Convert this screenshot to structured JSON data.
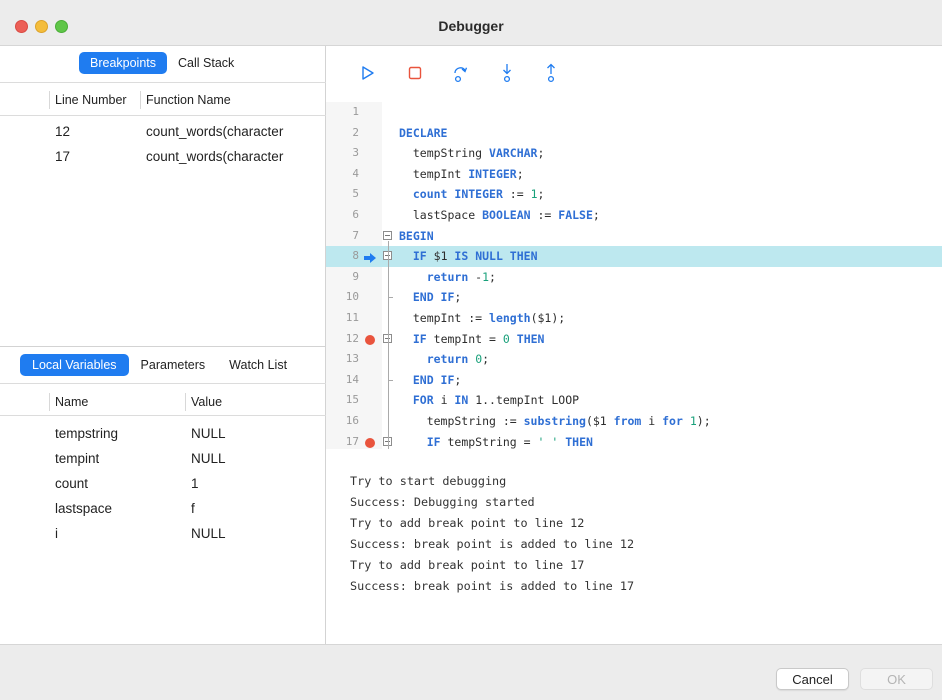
{
  "window": {
    "title": "Debugger"
  },
  "breakpoints_panel": {
    "tabs": [
      {
        "label": "Breakpoints",
        "active": true
      },
      {
        "label": "Call Stack",
        "active": false
      }
    ],
    "columns": [
      "Line Number",
      "Function Name"
    ],
    "rows": [
      {
        "line": "12",
        "function": "count_words(character"
      },
      {
        "line": "17",
        "function": "count_words(character"
      }
    ]
  },
  "variables_panel": {
    "tabs": [
      {
        "label": "Local Variables",
        "active": true
      },
      {
        "label": "Parameters",
        "active": false
      },
      {
        "label": "Watch List",
        "active": false
      }
    ],
    "columns": [
      "Name",
      "Value"
    ],
    "rows": [
      {
        "name": "tempstring",
        "value": "NULL"
      },
      {
        "name": "tempint",
        "value": "NULL"
      },
      {
        "name": "count",
        "value": "1"
      },
      {
        "name": "lastspace",
        "value": "f"
      },
      {
        "name": "i",
        "value": "NULL"
      }
    ]
  },
  "toolbar": {
    "buttons": [
      {
        "name": "continue-button",
        "icon": "play-icon"
      },
      {
        "name": "stop-button",
        "icon": "stop-icon"
      },
      {
        "name": "step-over-button",
        "icon": "step-over-icon"
      },
      {
        "name": "step-into-button",
        "icon": "step-into-icon"
      },
      {
        "name": "step-out-button",
        "icon": "step-out-icon"
      }
    ]
  },
  "editor": {
    "current_line": 8,
    "breakpoint_lines": [
      12,
      17
    ],
    "lines": [
      {
        "n": "1",
        "html": ""
      },
      {
        "n": "2",
        "html": "<span class=\"kw\">DECLARE</span>"
      },
      {
        "n": "3",
        "html": "  tempString <span class=\"kw\">VARCHAR</span>;"
      },
      {
        "n": "4",
        "html": "  tempInt <span class=\"kw\">INTEGER</span>;"
      },
      {
        "n": "5",
        "html": "  <span class=\"kw\">count INTEGER</span> := <span class=\"num\">1</span>;"
      },
      {
        "n": "6",
        "html": "  lastSpace <span class=\"kw\">BOOLEAN</span> := <span class=\"kw\">FALSE</span>;"
      },
      {
        "n": "7",
        "html": "<span class=\"kw\">BEGIN</span>"
      },
      {
        "n": "8",
        "html": "  <span class=\"kw\">IF</span> $1 <span class=\"kw\">IS NULL THEN</span>"
      },
      {
        "n": "9",
        "html": "    <span class=\"kw\">return</span> -<span class=\"num\">1</span>;"
      },
      {
        "n": "10",
        "html": "  <span class=\"kw\">END IF</span>;"
      },
      {
        "n": "11",
        "html": "  tempInt := <span class=\"fn\">length</span>($1);"
      },
      {
        "n": "12",
        "html": "  <span class=\"kw\">IF</span> tempInt = <span class=\"num\">0</span> <span class=\"kw\">THEN</span>"
      },
      {
        "n": "13",
        "html": "    <span class=\"kw\">return</span> <span class=\"num\">0</span>;"
      },
      {
        "n": "14",
        "html": "  <span class=\"kw\">END IF</span>;"
      },
      {
        "n": "15",
        "html": "  <span class=\"kw\">FOR</span> i <span class=\"kw\">IN</span> 1..tempInt LOOP"
      },
      {
        "n": "16",
        "html": "    tempString := <span class=\"fn\">substring</span>($1 <span class=\"kw\">from</span> i <span class=\"kw\">for</span> <span class=\"num\">1</span>);"
      },
      {
        "n": "17",
        "html": "    <span class=\"kw\">IF</span> tempString = <span class=\"num\">' '</span> <span class=\"kw\">THEN</span>"
      }
    ]
  },
  "console": {
    "lines": [
      "Try to start debugging",
      "Success: Debugging started",
      "Try to add break point to line 12",
      "Success: break point is added to line 12",
      "Try to add break point to line 17",
      "Success: break point is added to line 17"
    ]
  },
  "footer": {
    "cancel_label": "Cancel",
    "ok_label": "OK"
  },
  "colors": {
    "accent": "#1f7cf0",
    "current_line_bg": "#bde8ef",
    "breakpoint": "#e9543d",
    "keyword": "#2f6fd4",
    "number": "#18a07a"
  }
}
